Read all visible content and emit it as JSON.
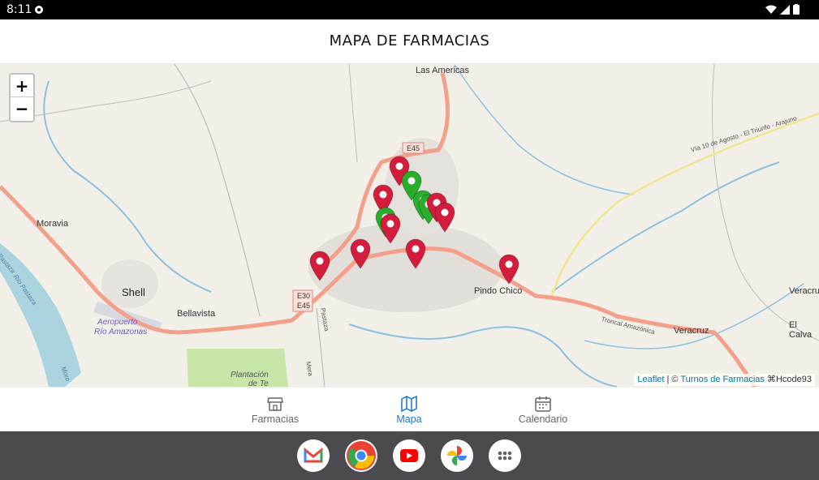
{
  "status_bar": {
    "time": "8:11"
  },
  "header": {
    "title": "MAPA DE FARMACIAS"
  },
  "map": {
    "zoom_in_label": "+",
    "zoom_out_label": "−",
    "labels": {
      "las_americas": "Las Americas",
      "moravia": "Moravia",
      "shell": "Shell",
      "bellavista": "Bellavista",
      "aeropuerto": "Aeropuerto",
      "rio_amazonas": "Río Amazonas",
      "pindo_chico": "Pindo Chico",
      "veracruz": "Veracruz",
      "veracru": "Veracru",
      "el_calva": "El Calva",
      "plantacion": "Plantación",
      "de_te": "de Te",
      "via_10_agosto": "Vía 10 de Agosto - El Triunfo - Arajuno",
      "troncal": "Troncal Amazónica",
      "mera": "Mera",
      "pastaza": "Pastaza",
      "e45_top": "E45",
      "e30": "E30",
      "e45_bottom": "E45",
      "rio_pastaza": "Río Pastaza",
      "river_left": "Pastaza",
      "moro": "Moro"
    },
    "marker_colors": {
      "red": "#d41c3c",
      "green": "#2aad2a"
    },
    "attribution": {
      "leaflet": "Leaflet",
      "separator": " | © ",
      "provider": "Turnos de Farmacias",
      "suffix": " ⌘Hcode93"
    }
  },
  "bottom_nav": {
    "items": [
      {
        "label": "Farmacias",
        "icon": "store-icon",
        "active": false
      },
      {
        "label": "Mapa",
        "icon": "map-icon",
        "active": true
      },
      {
        "label": "Calendario",
        "icon": "calendar-icon",
        "active": false
      }
    ]
  },
  "dock": {
    "apps": [
      "gmail-icon",
      "chrome-icon",
      "youtube-icon",
      "photos-icon",
      "app-drawer-icon"
    ]
  }
}
